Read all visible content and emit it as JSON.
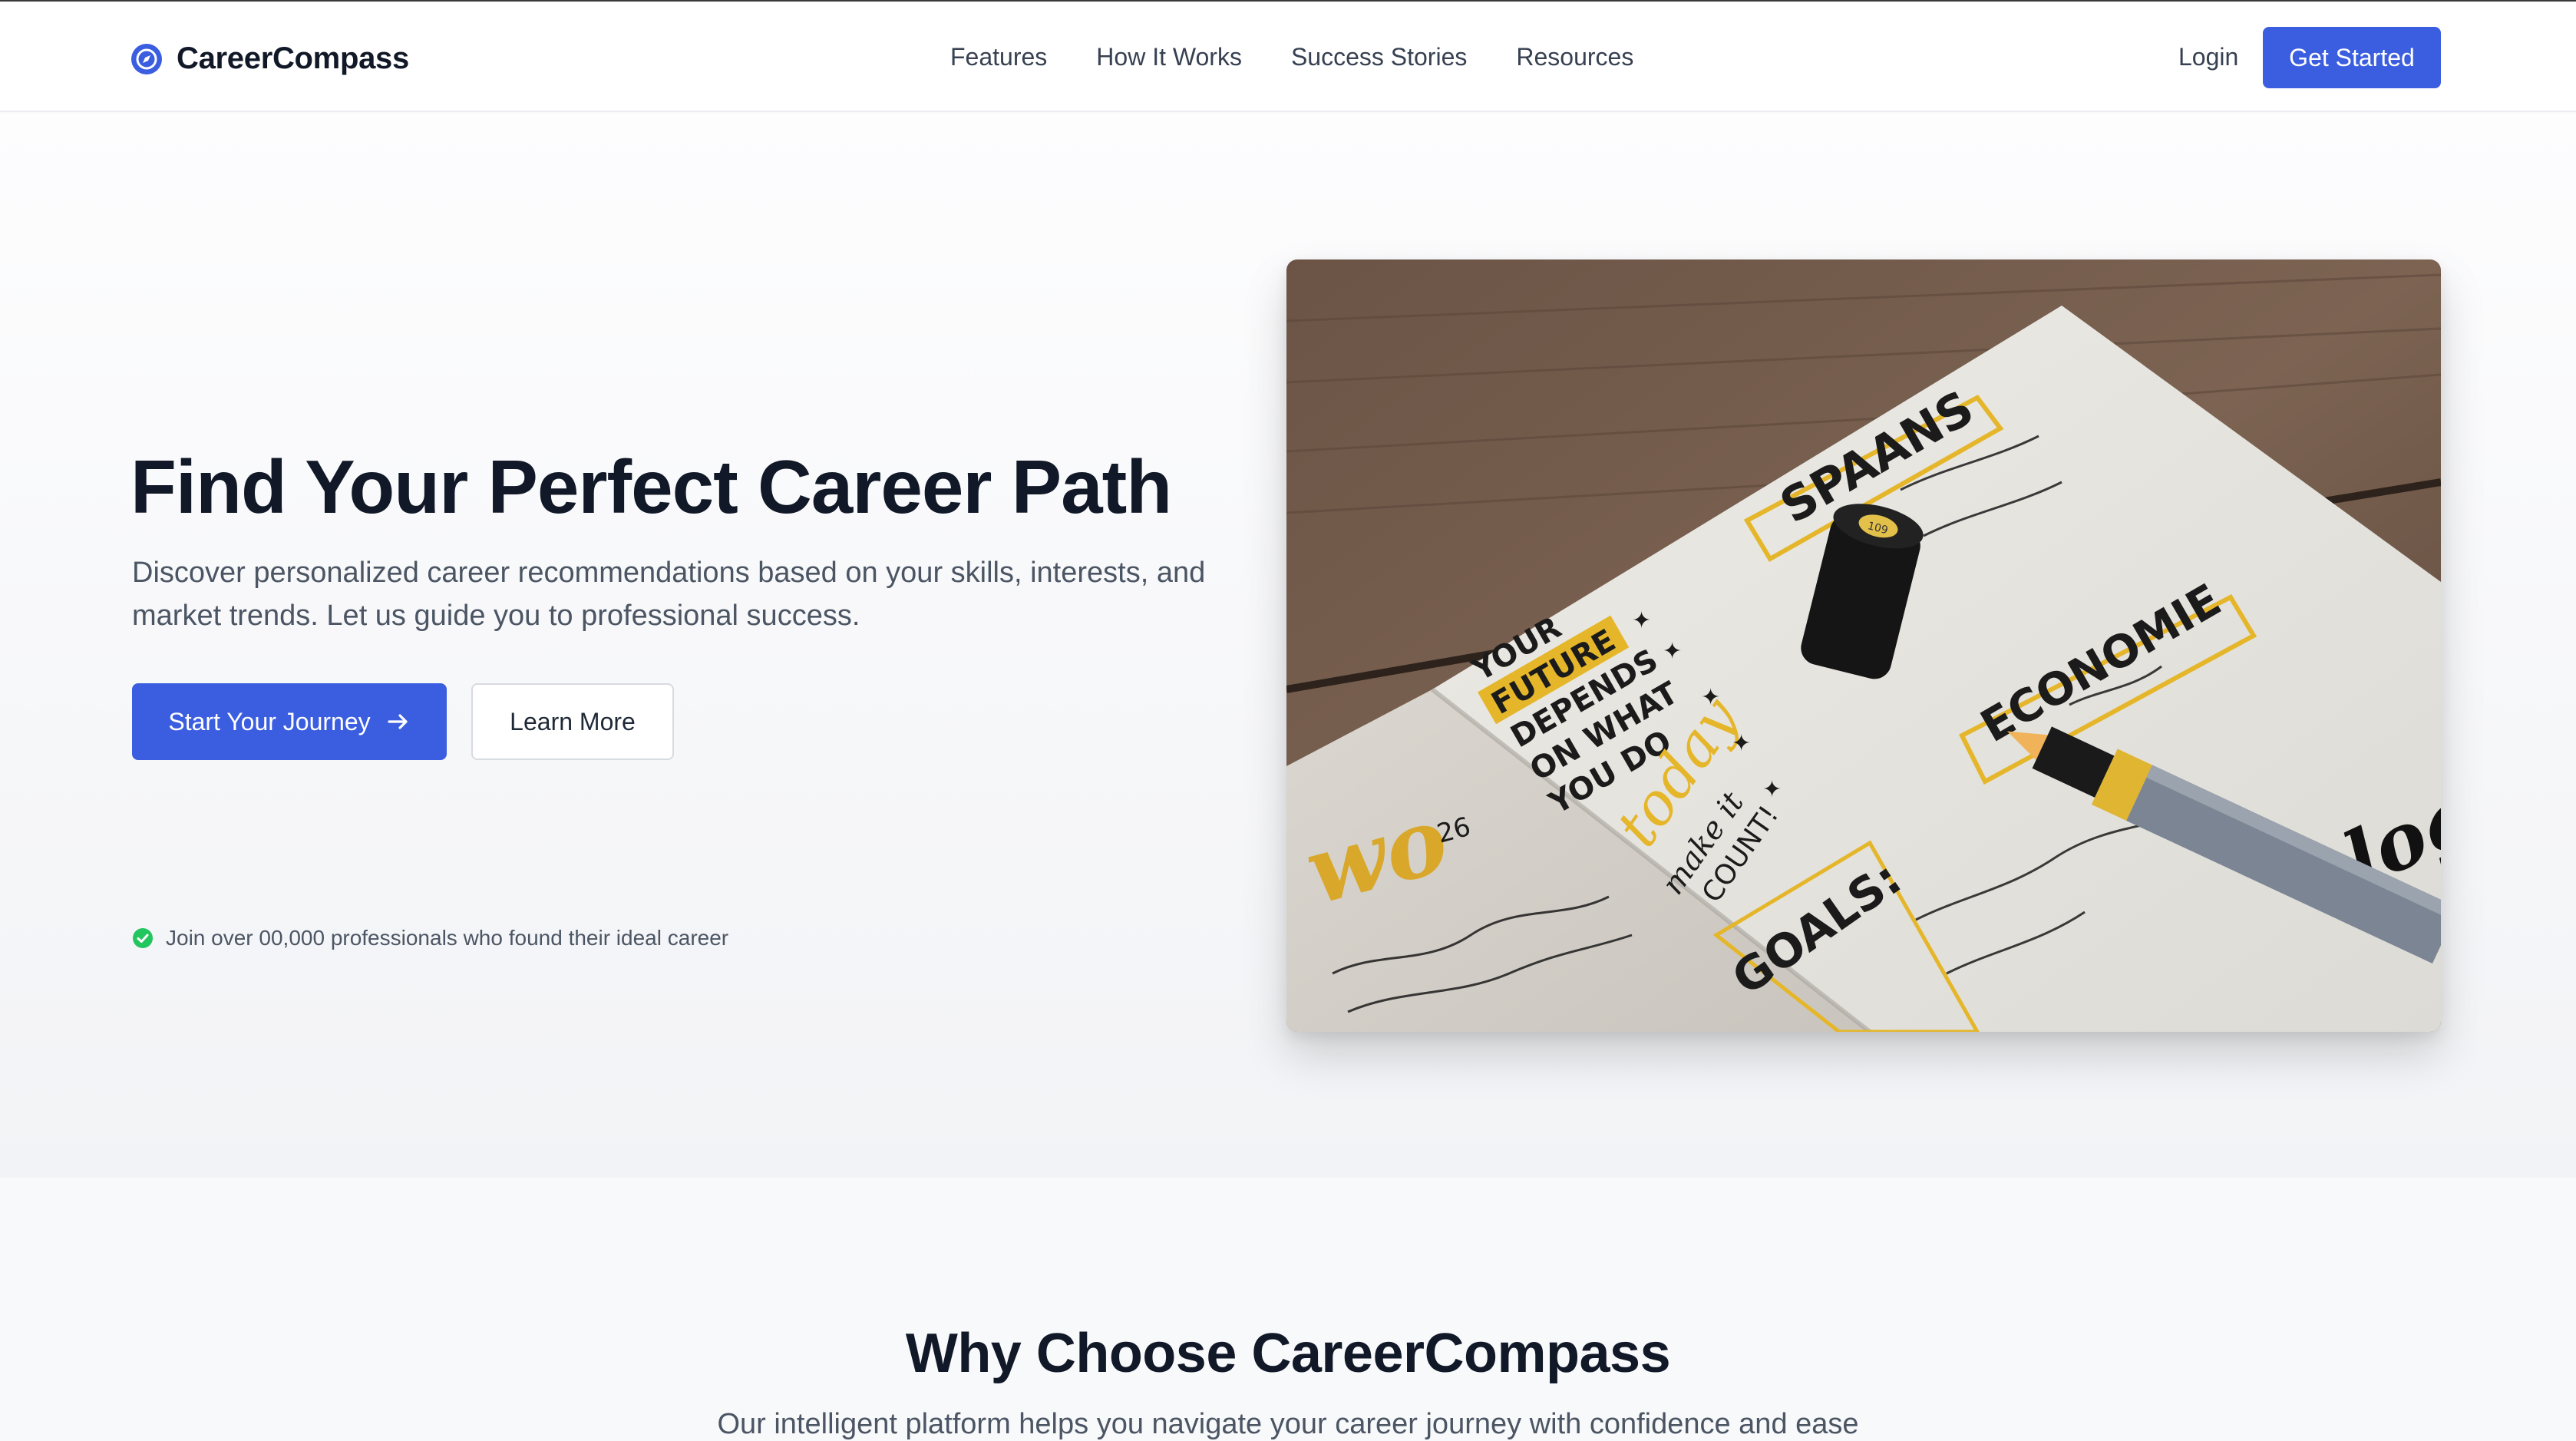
{
  "brand": {
    "name": "CareerCompass",
    "icon": "compass-icon",
    "accent_color": "#3b5ee0"
  },
  "nav": {
    "links": [
      {
        "label": "Features"
      },
      {
        "label": "How It Works"
      },
      {
        "label": "Success Stories"
      },
      {
        "label": "Resources"
      }
    ],
    "login_label": "Login",
    "get_started_label": "Get Started"
  },
  "hero": {
    "title": "Find Your Perfect Career Path",
    "subtitle": "Discover personalized career recommendations based on your skills, interests, and market trends. Let us guide you to professional success.",
    "primary_button": {
      "label": "Start Your Journey",
      "icon": "arrow-right-icon"
    },
    "secondary_button": {
      "label": "Learn More"
    },
    "social_proof": {
      "icon": "check-circle-icon",
      "text": "Join over 00,000 professionals who found their ideal career",
      "icon_color": "#22c55e"
    },
    "image": {
      "marker_cap_label": "109",
      "journal_words": [
        "SPAANS",
        "ECONOMIE",
        "YOUR",
        "FUTURE",
        "DEPENDS",
        "ON WHAT",
        "YOU DO",
        "today",
        "make it",
        "COUNT!",
        "GOALS:",
        "26"
      ]
    }
  },
  "features_section": {
    "title": "Why Choose CareerCompass",
    "subtitle": "Our intelligent platform helps you navigate your career journey with confidence and ease"
  }
}
